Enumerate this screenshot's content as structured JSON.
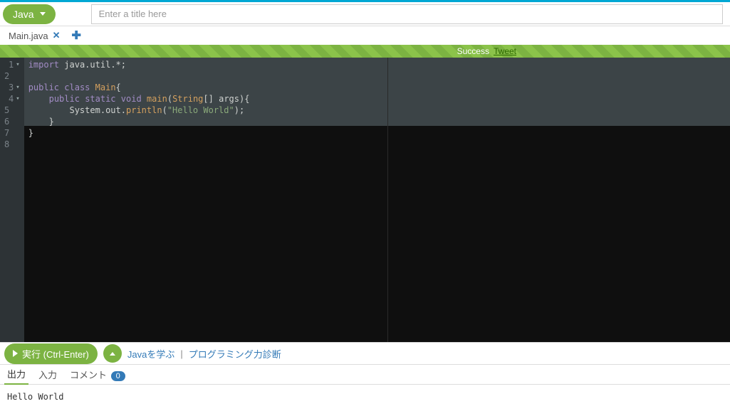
{
  "header": {
    "language": "Java",
    "title_value": "",
    "title_placeholder": "Enter a title here"
  },
  "tabs": {
    "file_name": "Main.java"
  },
  "status": {
    "text": "Success",
    "tweet": "Tweet"
  },
  "editor": {
    "line_count": 8,
    "fold_lines": [
      1,
      3,
      4
    ],
    "code_lines": [
      {
        "tokens": [
          [
            "kw",
            "import"
          ],
          [
            "punct",
            " java"
          ],
          [
            "punct",
            "."
          ],
          [
            "ident",
            "util"
          ],
          [
            "punct",
            ".*;"
          ]
        ]
      },
      {
        "tokens": []
      },
      {
        "tokens": [
          [
            "kw",
            "public"
          ],
          [
            "punct",
            " "
          ],
          [
            "kw",
            "class"
          ],
          [
            "punct",
            " "
          ],
          [
            "type",
            "Main"
          ],
          [
            "punct",
            "{"
          ]
        ]
      },
      {
        "tokens": [
          [
            "punct",
            "    "
          ],
          [
            "kw",
            "public"
          ],
          [
            "punct",
            " "
          ],
          [
            "kw",
            "static"
          ],
          [
            "punct",
            " "
          ],
          [
            "kw",
            "void"
          ],
          [
            "punct",
            " "
          ],
          [
            "fn",
            "main"
          ],
          [
            "punct",
            "("
          ],
          [
            "type",
            "String"
          ],
          [
            "punct",
            "[] args){"
          ]
        ]
      },
      {
        "tokens": [
          [
            "punct",
            "        System"
          ],
          [
            "punct",
            "."
          ],
          [
            "ident",
            "out"
          ],
          [
            "punct",
            "."
          ],
          [
            "fn",
            "println"
          ],
          [
            "punct",
            "("
          ],
          [
            "str",
            "\"Hello World\""
          ],
          [
            "punct",
            ");"
          ]
        ]
      },
      {
        "tokens": [
          [
            "punct",
            "    }"
          ]
        ]
      },
      {
        "tokens": [
          [
            "punct",
            "}"
          ]
        ]
      },
      {
        "tokens": []
      }
    ]
  },
  "run": {
    "button_label": "実行 (Ctrl-Enter)",
    "link_learn": "Javaを学ぶ",
    "link_diag": "プログラミング力診断"
  },
  "io": {
    "tab_output": "出力",
    "tab_input": "入力",
    "tab_comment": "コメント",
    "comment_count": "0",
    "output_text": "Hello World"
  }
}
